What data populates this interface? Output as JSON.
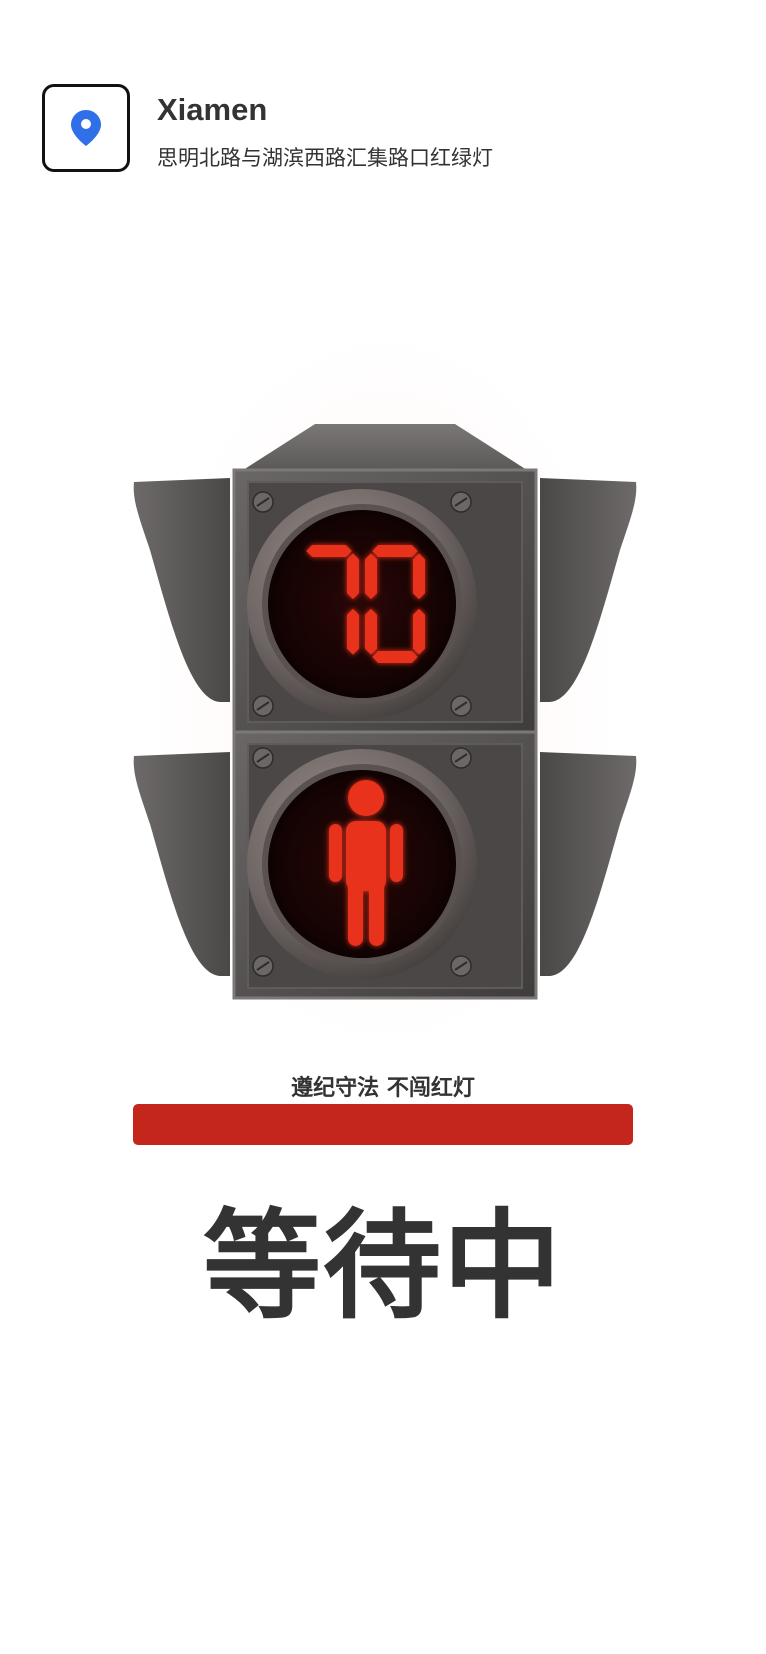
{
  "header": {
    "city": "Xiamen",
    "location": "思明北路与湖滨西路汇集路口红绿灯",
    "icon": "location-pin-icon",
    "accent_color": "#2f6fe8"
  },
  "signal": {
    "countdown": "70",
    "state": "red",
    "red_color": "#e8301f"
  },
  "slogan": "遵纪守法 不闯红灯",
  "status_bar_color": "#c4261c",
  "status_text": "等待中"
}
